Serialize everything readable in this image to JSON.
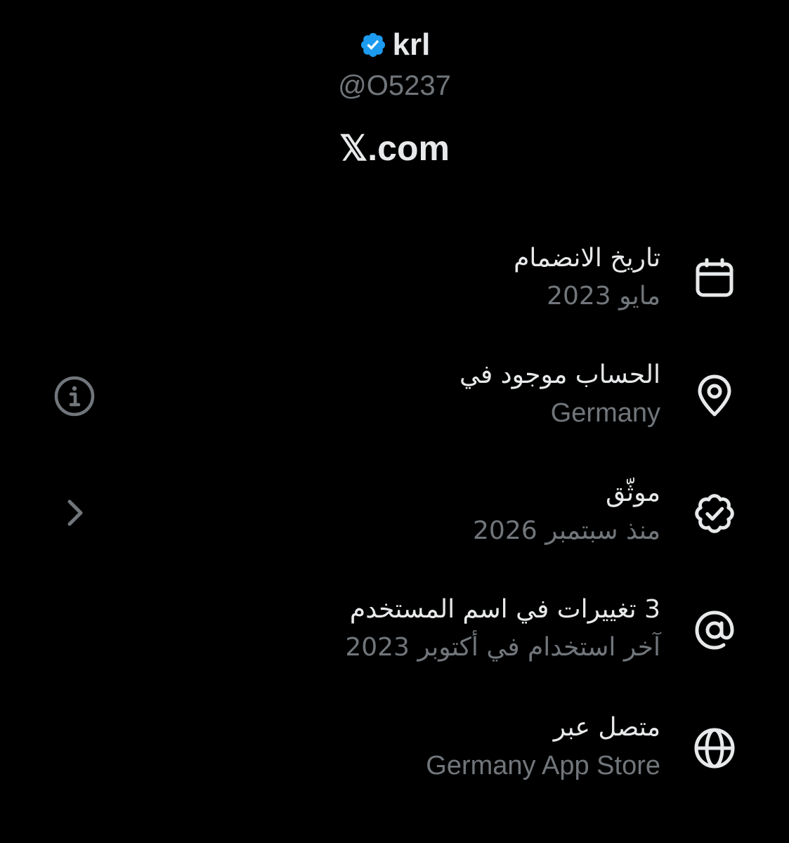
{
  "profile": {
    "display_name": "krl",
    "handle": "@O5237",
    "site": "𝕏.com",
    "accent_color": "#1d9bf0"
  },
  "rows": [
    {
      "icon": "calendar-icon",
      "title": "تاريخ الانضمام",
      "subtitle": "مايو 2023"
    },
    {
      "icon": "location-pin-icon",
      "title": "الحساب موجود في",
      "subtitle": "Germany",
      "side_icon": "info-icon"
    },
    {
      "icon": "verified-outline-icon",
      "title": "موثّق",
      "subtitle": "منذ سبتمبر 2026",
      "side_icon": "chevron-right-icon"
    },
    {
      "icon": "at-sign-icon",
      "title": "3 تغييرات في اسم المستخدم",
      "subtitle": "آخر استخدام في أكتوبر 2023"
    },
    {
      "icon": "globe-icon",
      "title": "متصل عبر",
      "subtitle": "Germany App Store"
    }
  ],
  "colors": {
    "background": "#000000",
    "primary_text": "#e7e9ea",
    "secondary_text": "#71767b"
  }
}
